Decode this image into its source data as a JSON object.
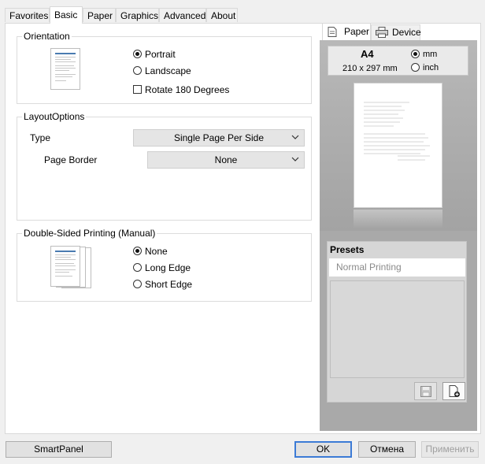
{
  "tabs": [
    "Favorites",
    "Basic",
    "Paper",
    "Graphics",
    "Advanced",
    "About"
  ],
  "orientation": {
    "legend": "Orientation",
    "portrait": "Portrait",
    "landscape": "Landscape",
    "rotate": "Rotate 180 Degrees",
    "selected": "Portrait",
    "rotate_checked": false
  },
  "layout": {
    "legend": "LayoutOptions",
    "type_label": "Type",
    "type_value": "Single Page Per Side",
    "border_label": "Page Border",
    "border_value": "None"
  },
  "duplex": {
    "legend": "Double-Sided Printing (Manual)",
    "none": "None",
    "long_edge": "Long Edge",
    "short_edge": "Short Edge",
    "selected": "None"
  },
  "preview": {
    "tabs": [
      "Paper",
      "Device"
    ],
    "paper_size": "A4",
    "dimensions": "210 x 297 mm",
    "unit_mm": "mm",
    "unit_inch": "inch",
    "unit_selected": "mm"
  },
  "presets": {
    "title": "Presets",
    "value": "Normal Printing"
  },
  "buttons": {
    "smartpanel": "SmartPanel",
    "ok": "OK",
    "cancel": "Отмена",
    "apply": "Применить"
  },
  "colors": {
    "accent": "#3c7bd6",
    "sidebar_bg": "#a9a9a9",
    "preset_header": "#d6d6d6"
  }
}
